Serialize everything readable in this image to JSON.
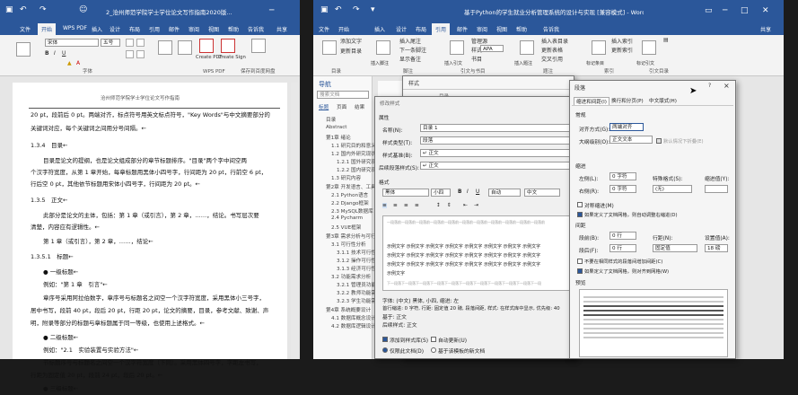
{
  "left_window": {
    "title": "2_沧州师范学院学士学位论文写作指南2020版...",
    "tabs": [
      "文件",
      "开始",
      "WPS PDF",
      "插入",
      "设计",
      "布局",
      "引用",
      "邮件",
      "审阅",
      "视图",
      "帮助",
      "告诉我",
      "共享"
    ],
    "ribbon": {
      "font_name": "宋体",
      "font_size": "五号",
      "create_pdf": "Create PDF",
      "create_sign": "Create Sign",
      "group_font": "字体",
      "group_wps": "WPS PDF",
      "group_save": "保存到百度网盘"
    },
    "header_text": "沧州师范学院学士学位论文写作指南",
    "doc_lines": [
      "20 pt，段前后 0 pt。两端对齐，标点符号用英文标点符号，\"Key Words\"与中文摘要部分的",
      "关键词对应，每个关键词之间用分号间隔。←",
      "1.3.4　目录←",
      "目录是论文的提纲，也是论文组成部分的章节标题排序。\"目录\"两个字中间空两",
      "个汉字符宽度，从第 1 章开始，每章标题用黑体小四号字，行间距为 20 pt，行前空 6 pt，",
      "行后空 0 pt，其他依节标题用宋体小四号字，行间距为 20 pt。←",
      "1.3.5　正文←",
      "此部分是论文的主体，包括：第 1 章（或引言），第 2 章，……，结论。书写层次要",
      "清楚，内容应有逻辑性。←",
      "第 1 章（或引言），第 2 章，……，结论←",
      "1.3.5.1　标题←",
      "● 一级标题←",
      "例如：\"第 1 章　引言\"←",
      "章序号采用阿拉伯数字，章序号与标题名之间空一个汉字符宽度，采用黑体小三号字，",
      "居中书写，段前 40 pt，段后 20 pt，行距 20 pt，论文的摘要，目录，参考文献、致谢、声",
      "明，附录等部分的标题与章标题属于同一等级，也使用上述格式。←",
      "● 二级标题←",
      "例如：\"2.1　实验装置与实验方法\"←",
      "节标题序号与标题名之间空一个汉字符宽度（下同）。采用黑体四号字，字距左书写，",
      "行距为固定值 20 pt，段前 24 pt，段后 20 pt。←",
      "● 三级标题←"
    ]
  },
  "right_window": {
    "title": "基于Python的学生就业分析管理系统的设计与实现 [兼容模式] - Word",
    "tabs": [
      "文件",
      "开始",
      "插入",
      "设计",
      "布局",
      "引用",
      "邮件",
      "审阅",
      "视图",
      "帮助",
      "告诉我",
      "共享"
    ],
    "ribbon": {
      "add_text": "添加文字",
      "update_toc": "更新目录",
      "insert_footnote": "插入脚注",
      "insert_endnote": "插入尾注",
      "next_footnote": "下一条脚注",
      "show_notes": "显示备注",
      "insert_citation": "插入引文",
      "manage_sources": "管理源",
      "style": "样式",
      "style_value": "APA",
      "bibliography": "书目",
      "insert_caption": "插入题注",
      "insert_table_of_figures": "插入表目录",
      "update_table": "更新表格",
      "cross_reference": "交叉引用",
      "mark_entry": "标记条目",
      "insert_index": "插入索引",
      "update_index": "更新索引",
      "mark_citation": "标记引文",
      "group_toc": "目录",
      "group_footnotes": "脚注",
      "group_citations": "引文与书目",
      "group_captions": "题注",
      "group_index": "索引",
      "group_toa": "引文目录"
    },
    "nav": {
      "title": "导航",
      "search_placeholder": "搜索文档",
      "tabs": [
        "标题",
        "页面",
        "结果"
      ],
      "items": [
        "目录",
        "Abstract",
        "第1章 绪论",
        "1.1 研究目的和意义",
        "1.2 国内外研究现状",
        "1.2.1 国外研究现状",
        "1.2.2 国内研究现状",
        "1.3 研究内容",
        "第2章 开发语言、工具",
        "2.1 Python语言",
        "2.2 Django框架",
        "2.3 MySQL数据库",
        "2.4 Pycharm",
        "2.5 VUE框架",
        "第3章 需求分析与可行性",
        "3.1 可行性分析",
        "3.1.1 技术可行性",
        "3.1.2 操作可行性",
        "3.1.3 经济可行性",
        "3.2 功能需求分析",
        "3.2.1 管理员功能",
        "3.2.2 教师功能需求",
        "3.2.3 学生功能需求",
        "第4章 系统概要设计",
        "4.1 数据库概念设计",
        "4.2 数据库逻辑设计"
      ]
    }
  },
  "styles_pane": {
    "title": "样式",
    "title2": "目录"
  },
  "modify_style_dialog": {
    "title": "修改样式",
    "section_properties": "属性",
    "name_label": "名称(N):",
    "name_value": "目录 1",
    "type_label": "样式类型(T):",
    "type_value": "段落",
    "based_on_label": "样式基准(B):",
    "based_on_value": "↵ 正文",
    "following_label": "后续段落样式(S):",
    "following_value": "↵ 正文",
    "section_format": "格式",
    "font_value": "黑体",
    "size_value": "小四",
    "color_value": "自动",
    "lang_value": "中文",
    "preview_prev": "一段落前一段落前一段落前一段落前一段落前一段落前一段落前一段落前一段落前一段落前一段落前",
    "preview_text1": "示例文字 示例文字 示例文字 示例文字 示例文字 示例文字 示例文字 示例文字",
    "preview_text2": "示例文字 示例文字 示例文字 示例文字 示例文字 示例文字 示例文字 示例文字",
    "preview_text3": "示例文字 示例文字 示例文字 示例文字 示例文字 示例文字 示例文字 示例文字",
    "preview_text4": "示例文字",
    "preview_next": "下一段落下一段落下一段落下一段落下一段落下一段落下一段落下一段落下一段落下一段落下一段",
    "desc1": "字体: (中文) 黑体, 小四, 缩进: 左",
    "desc2": "  首行缩进: 0 字符, 行距: 固定值 20 磅, 段落间距, 样式: 在样式库中显示, 优先级: 40",
    "desc3": "  基于: 正文",
    "desc4": "  后续样式: 正文",
    "add_to_gallery": "添加到样式库(S)",
    "auto_update": "自动更新(U)",
    "only_this_doc": "仅限此文档(D)",
    "new_docs": "基于该模板的新文档"
  },
  "paragraph_dialog": {
    "title": "段落",
    "help": "?",
    "close": "×",
    "tabs": [
      "缩进和间距(I)",
      "换行和分页(P)",
      "中文版式(H)"
    ],
    "section_general": "常规",
    "alignment_label": "对齐方式(G):",
    "alignment_value": "两端对齐",
    "outline_label": "大纲级别(O):",
    "outline_value": "正文文本",
    "collapsed_label": "默认情况下折叠(E)",
    "section_indent": "缩进",
    "left_label": "左侧(L):",
    "left_value": "0 字符",
    "right_label": "右侧(R):",
    "right_value": "0 字符",
    "special_label": "特殊格式(S):",
    "special_value": "(无)",
    "indent_value_label": "缩进值(Y):",
    "mirror_label": "对称缩进(M)",
    "auto_adjust_label": "如果定义了文档网格，则自动调整右缩进(D)",
    "section_spacing": "间距",
    "before_label": "段前(B):",
    "before_value": "0 行",
    "after_label": "段后(F):",
    "after_value": "0 行",
    "line_spacing_label": "行距(N):",
    "line_spacing_value": "固定值",
    "at_label": "设置值(A):",
    "at_value": "18 磅",
    "no_space_label": "不要在相同样式的段落间增加间距(C)",
    "snap_grid_label": "如果定义了文档网格，则对齐到网格(W)",
    "section_preview": "预览"
  }
}
